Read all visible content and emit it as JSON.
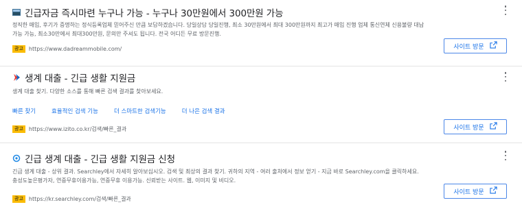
{
  "visit_label": "사이트 방문",
  "badge_label": "광고",
  "ads": [
    {
      "title": "긴급자금 즉시마련 누구나 가능 - 누구나 30만원에서 300만원 가능",
      "description": "정직한 매입, 후기가 증명하는 정식등록업체 믿어주신 만큼 보답하겠습니다. 당일상담 당일진행, 최소 30만원에서 최대 300만원까지 최고가 매입 진행 업체 통신연체 신용불량 대납가능 가능, 최소30만에서 최대300만원, 문의만 주셔도 됩니다. 전국 어디든 무료 방문진행.",
      "url": "https://www.dadreammobile.com/"
    },
    {
      "title": "생계 대출 - 긴급 생활 지원금",
      "description": "생계 대출 찾기. 다양한 소스를 통해 빠른 검색 결과를 찾아보세요.",
      "sitelinks": [
        "빠른 찾기",
        "효율적인 검색 기능",
        "더 스마트한 검색기능",
        "더 나은 검색 결과"
      ],
      "url": "https://www.izito.co.kr/검색/빠른_결과"
    },
    {
      "title": "긴급 생계 대출 - 긴급 생활 지원금 신청",
      "description": "긴급 생계 대출 - 상위 결과. Searchley에서 자세히 알아보십시오. 검색 및 최상의 결과 찾기. 귀하의 지역 - 여러 출처에서 정보 얻기 - 지금 바로 Searchley.com을 클릭하세요. 충성도높은평가자, 연중무휴이용가능, 연중무휴 이용가능. 신뢰받는 사이트. 웹, 이미지 및 비디오.",
      "url": "https://kr.searchley.com/검색/빠른_결과"
    }
  ],
  "colors": {
    "link": "#1a73e8",
    "badge": "#fbbc04",
    "border": "#4a86e8"
  },
  "icons": [
    "favicon-dadream",
    "favicon-izito",
    "favicon-searchley",
    "external-link-icon",
    "more-vert-icon"
  ]
}
